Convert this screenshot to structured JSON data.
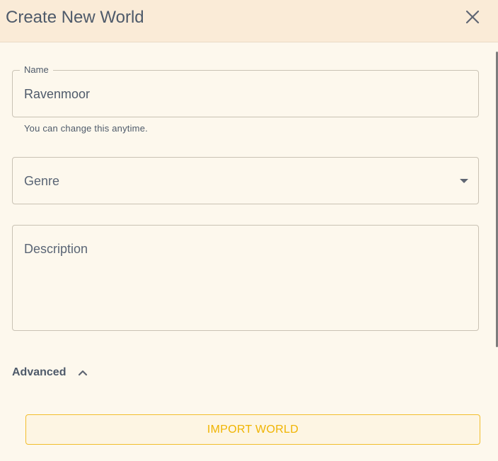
{
  "dialog": {
    "title": "Create New World",
    "close_icon": "close-icon"
  },
  "name_field": {
    "label": "Name",
    "value": "Ravenmoor",
    "helper": "You can change this anytime."
  },
  "genre_field": {
    "placeholder": "Genre",
    "icon": "dropdown-caret-icon"
  },
  "description_field": {
    "placeholder": "Description"
  },
  "advanced": {
    "label": "Advanced",
    "icon": "chevron-up-icon"
  },
  "import_button": {
    "label": "IMPORT WORLD"
  },
  "colors": {
    "header_bg": "#faebd7",
    "body_bg": "#fdf8ed",
    "accent": "#f0b400"
  }
}
